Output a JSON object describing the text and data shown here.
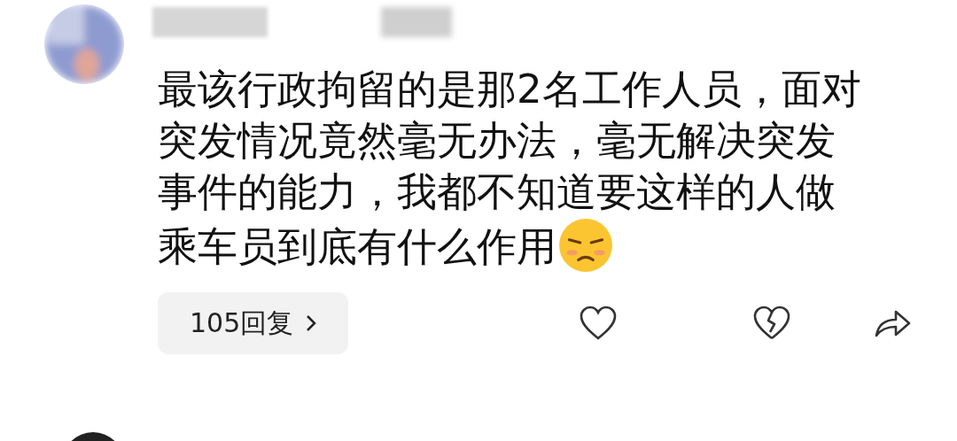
{
  "comment": {
    "text": "最该行政拘留的是那2名工作人员，面对突发情况竟然毫无办法，毫无解决突发事件的能力，我都不知道要这样的人做乘车员到底有什么作用",
    "reply_button": {
      "label": "105回复"
    }
  }
}
